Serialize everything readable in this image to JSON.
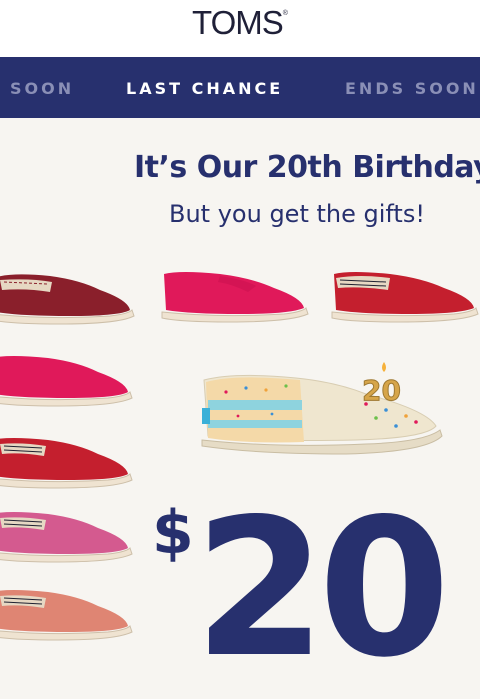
{
  "brand": {
    "logo": "TOMS",
    "trademark": "®"
  },
  "ticker": {
    "items": [
      "SOON",
      "LAST CHANCE",
      "ENDS SOON"
    ]
  },
  "hero": {
    "headline": "It’s Our 20th Birthday",
    "subheadline": "But you get the gifts!",
    "price_currency": "$",
    "price_value": "20",
    "candle_number": "20"
  },
  "colors": {
    "navy": "#27306e",
    "burgundy": "#8a1f2b",
    "magenta": "#e0195a",
    "red": "#c41f2e",
    "pink": "#d45a8f",
    "salmon": "#df8573",
    "cream": "#efe6cf"
  },
  "shoes": [
    {
      "name": "shoe-burgundy",
      "color": "#8a1f2b"
    },
    {
      "name": "shoe-magenta-top",
      "color": "#e0195a"
    },
    {
      "name": "shoe-red-top",
      "color": "#c41f2e"
    },
    {
      "name": "shoe-magenta-left",
      "color": "#e0195a"
    },
    {
      "name": "shoe-red-left",
      "color": "#c41f2e"
    },
    {
      "name": "shoe-pink-left",
      "color": "#d45a8f"
    },
    {
      "name": "shoe-salmon-left",
      "color": "#df8573"
    },
    {
      "name": "shoe-birthday-cake",
      "color": "#efe6cf"
    }
  ]
}
